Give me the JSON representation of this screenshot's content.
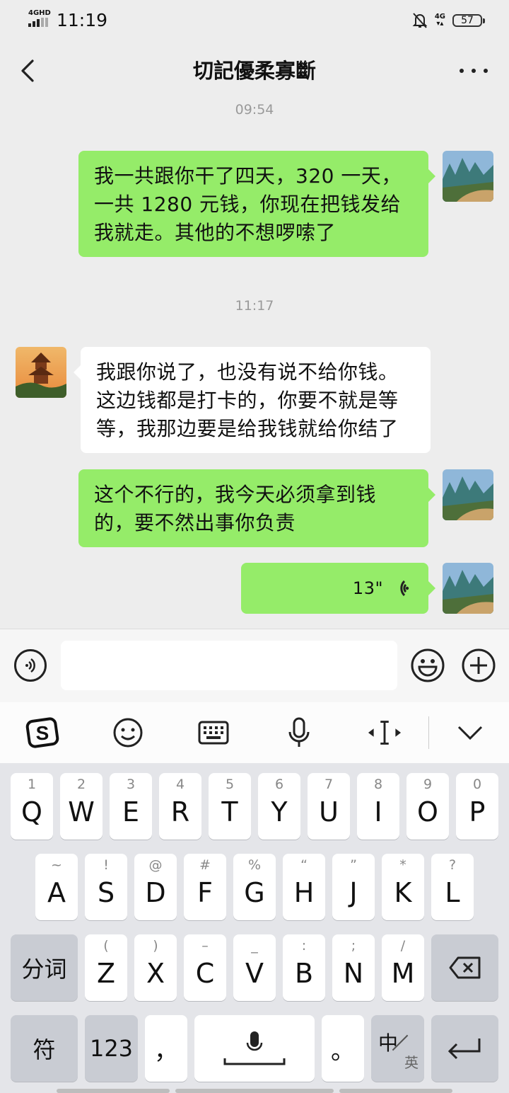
{
  "status": {
    "network_left": "4GHD",
    "time": "11:19",
    "network_right": "4G",
    "battery": "57"
  },
  "header": {
    "title": "切記優柔寡斷"
  },
  "messages": {
    "ts1": "09:54",
    "m1": "我一共跟你干了四天，320 一天，一共 1280 元钱，你现在把钱发给我就走。其他的不想啰嗦了",
    "ts2": "11:17",
    "m2": "我跟你说了，也没有说不给你钱。这边钱都是打卡的，你要不就是等等，我那边要是给我钱就给你结了",
    "m3": "这个不行的，我今天必须拿到钱的，要不然出事你负责",
    "m4_duration": "13\""
  },
  "input": {
    "value": "",
    "placeholder": ""
  },
  "keyboard": {
    "row1": [
      {
        "hint": "1",
        "key": "Q"
      },
      {
        "hint": "2",
        "key": "W"
      },
      {
        "hint": "3",
        "key": "E"
      },
      {
        "hint": "4",
        "key": "R"
      },
      {
        "hint": "5",
        "key": "T"
      },
      {
        "hint": "6",
        "key": "Y"
      },
      {
        "hint": "7",
        "key": "U"
      },
      {
        "hint": "8",
        "key": "I"
      },
      {
        "hint": "9",
        "key": "O"
      },
      {
        "hint": "0",
        "key": "P"
      }
    ],
    "row2": [
      {
        "hint": "~",
        "key": "A"
      },
      {
        "hint": "!",
        "key": "S"
      },
      {
        "hint": "@",
        "key": "D"
      },
      {
        "hint": "#",
        "key": "F"
      },
      {
        "hint": "%",
        "key": "G"
      },
      {
        "hint": "“",
        "key": "H"
      },
      {
        "hint": "”",
        "key": "J"
      },
      {
        "hint": "*",
        "key": "K"
      },
      {
        "hint": "?",
        "key": "L"
      }
    ],
    "row3": [
      {
        "hint": "(",
        "key": "Z"
      },
      {
        "hint": ")",
        "key": "X"
      },
      {
        "hint": "–",
        "key": "C"
      },
      {
        "hint": "_",
        "key": "V"
      },
      {
        "hint": ":",
        "key": "B"
      },
      {
        "hint": ";",
        "key": "N"
      },
      {
        "hint": "/",
        "key": "M"
      }
    ],
    "fenci": "分词",
    "symbol": "符",
    "numbers": "123",
    "comma": "，",
    "period": "。",
    "lang_main": "中",
    "lang_sub": "英"
  }
}
